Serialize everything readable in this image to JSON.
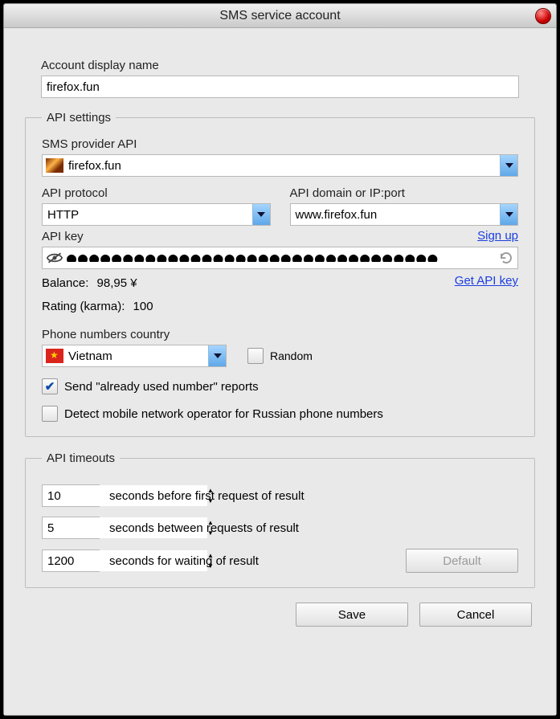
{
  "window": {
    "title": "SMS service account"
  },
  "account": {
    "display_name_label": "Account display name",
    "display_name_value": "firefox.fun"
  },
  "api_settings": {
    "legend": "API settings",
    "provider_label": "SMS provider API",
    "provider_value": "firefox.fun",
    "protocol_label": "API protocol",
    "protocol_value": "HTTP",
    "domain_label": "API domain or IP:port",
    "domain_value": "www.firefox.fun",
    "signup_link": "Sign up",
    "apikey_label": "API key",
    "apikey_masked": "●●●●●●●●●●●●●●●●●●●●●●●●●●●●●●●●●",
    "get_apikey_link": "Get API key",
    "balance_label": "Balance:",
    "balance_value": "98,95 ¥",
    "rating_label": "Rating (karma):",
    "rating_value": "100",
    "country_label": "Phone numbers country",
    "country_value": "Vietnam",
    "random_label": "Random",
    "send_reports_label": "Send \"already used number\" reports",
    "detect_operator_label": "Detect mobile network operator for Russian phone numbers"
  },
  "timeouts": {
    "legend": "API timeouts",
    "first_request_value": "10",
    "first_request_label": "seconds before first request of result",
    "between_value": "5",
    "between_label": "seconds between requests of result",
    "wait_value": "1200",
    "wait_label": "seconds for waiting of result",
    "default_button": "Default"
  },
  "footer": {
    "save": "Save",
    "cancel": "Cancel"
  },
  "checkboxes": {
    "random": false,
    "send_reports": true,
    "detect_operator": false
  }
}
